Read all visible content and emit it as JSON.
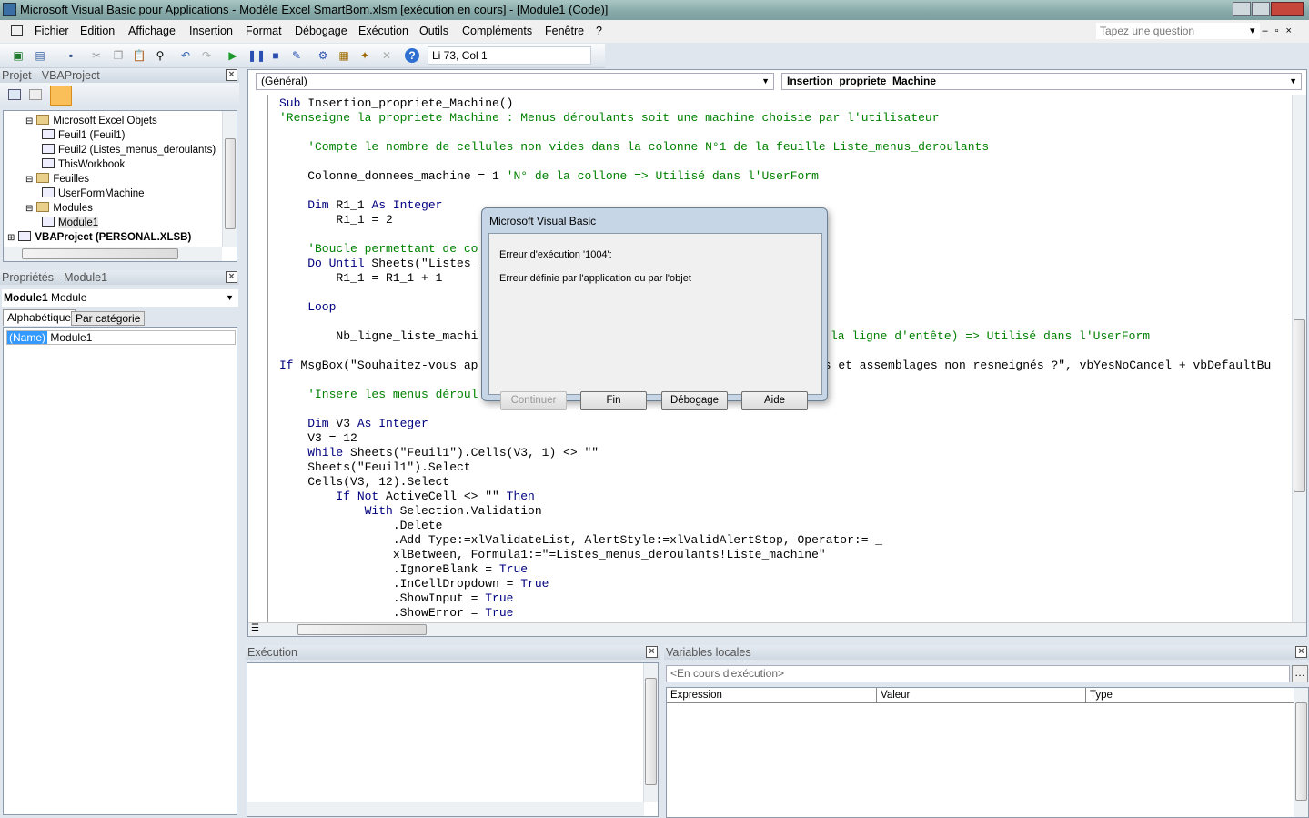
{
  "window": {
    "title": "Microsoft Visual Basic pour Applications - Modèle Excel SmartBom.xlsm [exécution en cours] - [Module1 (Code)]"
  },
  "menu": [
    "Fichier",
    "Edition",
    "Affichage",
    "Insertion",
    "Format",
    "Débogage",
    "Exécution",
    "Outils",
    "Compléments",
    "Fenêtre",
    "?"
  ],
  "ask_placeholder": "Tapez une question",
  "toolbar": {
    "position": "Li 73, Col 1"
  },
  "project": {
    "title": "Projet - VBAProject",
    "items": [
      {
        "label": "Microsoft Excel Objets",
        "level": 1
      },
      {
        "label": "Feuil1 (Feuil1)",
        "level": 2
      },
      {
        "label": "Feuil2 (Listes_menus_deroulants)",
        "level": 2
      },
      {
        "label": "ThisWorkbook",
        "level": 2
      },
      {
        "label": "Feuilles",
        "level": 1
      },
      {
        "label": "UserFormMachine",
        "level": 2
      },
      {
        "label": "Modules",
        "level": 1
      },
      {
        "label": "Module1",
        "level": 2
      },
      {
        "label": "VBAProject (PERSONAL.XLSB)",
        "level": 0
      }
    ]
  },
  "properties": {
    "title": "Propriétés - Module1",
    "object_name": "Module1",
    "object_type": "Module",
    "tabs": [
      "Alphabétique",
      "Par catégorie"
    ],
    "row_key": "(Name)",
    "row_value": "Module1"
  },
  "code": {
    "object_combo": "(Général)",
    "proc_combo": "Insertion_propriete_Machine",
    "lines": [
      [
        [
          "Sub ",
          "kw"
        ],
        [
          "Insertion_propriete_Machine()",
          "tx"
        ]
      ],
      [
        [
          "'Renseigne la propriete Machine : Menus déroulants soit une machine choisie par l'utilisateur",
          "cm"
        ]
      ],
      [],
      [
        [
          "    'Compte le nombre de cellules non vides dans la colonne N°1 de la feuille Liste_menus_deroulants",
          "cm"
        ]
      ],
      [],
      [
        [
          "    Colonne_donnees_machine = 1 ",
          "tx"
        ],
        [
          "'N° de la collone => Utilisé dans l'UserForm",
          "cm"
        ]
      ],
      [],
      [
        [
          "    Dim ",
          "kw"
        ],
        [
          "R1_1 ",
          "tx"
        ],
        [
          "As Integer",
          "kw"
        ]
      ],
      [
        [
          "        R1_1 = 2",
          "tx"
        ]
      ],
      [],
      [
        [
          "    'Boucle permettant de co",
          "cm"
        ]
      ],
      [
        [
          "    Do Until ",
          "kw"
        ],
        [
          "Sheets(\"Listes_",
          "tx"
        ]
      ],
      [
        [
          "        R1_1 = R1_1 + 1",
          "tx"
        ]
      ],
      [],
      [
        [
          "    Loop",
          "kw"
        ]
      ],
      [],
      [
        [
          "        Nb_ligne_liste_machi",
          "tx"
        ]
      ],
      [],
      [
        [
          "If ",
          "kw"
        ],
        [
          "MsgBox(\"Souhaitez-vous ap",
          "tx"
        ]
      ],
      [],
      [
        [
          "    'Insere les menus déroul",
          "cm"
        ]
      ],
      [],
      [
        [
          "    Dim ",
          "kw"
        ],
        [
          "V3 ",
          "tx"
        ],
        [
          "As Integer",
          "kw"
        ]
      ],
      [
        [
          "    V3 = 12",
          "tx"
        ]
      ],
      [
        [
          "    While ",
          "kw"
        ],
        [
          "Sheets(\"Feuil1\").Cells(V3, 1) <> \"\"",
          "tx"
        ]
      ],
      [
        [
          "    Sheets(\"Feuil1\").Select",
          "tx"
        ]
      ],
      [
        [
          "    Cells(V3, 12).Select",
          "tx"
        ]
      ],
      [
        [
          "        If Not ",
          "kw"
        ],
        [
          "ActiveCell <> \"\" ",
          "tx"
        ],
        [
          "Then",
          "kw"
        ]
      ],
      [
        [
          "            With ",
          "kw"
        ],
        [
          "Selection.Validation",
          "tx"
        ]
      ],
      [
        [
          "                .Delete",
          "tx"
        ]
      ],
      [
        [
          "                .Add Type:=xlValidateList, AlertStyle:=xlValidAlertStop, Operator:= _",
          "tx"
        ]
      ],
      [
        [
          "                xlBetween, Formula1:=\"=Listes_menus_deroulants!Liste_machine\"",
          "tx"
        ]
      ],
      [
        [
          "                .IgnoreBlank = ",
          "tx"
        ],
        [
          "True",
          "kw"
        ]
      ],
      [
        [
          "                .InCellDropdown = ",
          "tx"
        ],
        [
          "True",
          "kw"
        ]
      ],
      [
        [
          "                .ShowInput = ",
          "tx"
        ],
        [
          "True",
          "kw"
        ]
      ],
      [
        [
          "                .ShowError = ",
          "tx"
        ],
        [
          "True",
          "kw"
        ]
      ]
    ],
    "fragments": [
      {
        "line": 16,
        "text": "la ligne d'entête) => Utilisé dans l'UserForm",
        "kind": "cm"
      },
      {
        "line": 18,
        "text": "es et assemblages non resneignés ?\", vbYesNoCancel + vbDefaultBu",
        "kind": "tx"
      }
    ]
  },
  "dialog": {
    "title": "Microsoft Visual Basic",
    "error": "Erreur d'exécution '1004':",
    "message": "Erreur définie par l'application ou par l'objet",
    "buttons": {
      "continue": "Continuer",
      "end": "Fin",
      "debug": "Débogage",
      "help": "Aide"
    }
  },
  "immediate": {
    "title": "Exécution"
  },
  "locals": {
    "title": "Variables locales",
    "context": "<En cours d'exécution>",
    "columns": [
      "Expression",
      "Valeur",
      "Type"
    ]
  }
}
